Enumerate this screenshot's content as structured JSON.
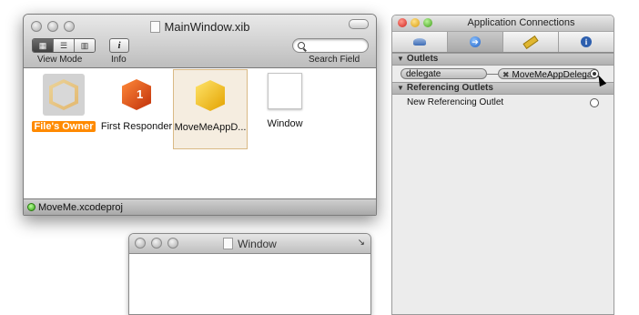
{
  "main_window": {
    "title": "MainWindow.xib",
    "toolbar": {
      "view_mode_label": "View Mode",
      "info_label": "Info",
      "info_glyph": "i",
      "search_label": "Search Field",
      "search_placeholder": ""
    },
    "objects": [
      {
        "label": "File's Owner",
        "icon": "placeholder-cube-icon",
        "selected": true
      },
      {
        "label": "First Responder",
        "icon": "first-responder-cube-icon"
      },
      {
        "label": "MoveMeAppD...",
        "icon": "object-cube-icon",
        "highlighted": true
      },
      {
        "label": "Window",
        "icon": "window-icon"
      }
    ],
    "status": {
      "project": "MoveMe.xcodeproj"
    }
  },
  "window_win": {
    "title": "Window"
  },
  "inspector": {
    "title": "Application Connections",
    "tabs": [
      {
        "icon": "attributes-icon",
        "active": false
      },
      {
        "icon": "connections-icon",
        "active": true
      },
      {
        "icon": "size-ruler-icon",
        "active": false
      },
      {
        "icon": "identity-info-icon",
        "active": false
      }
    ],
    "outlets": {
      "header": "Outlets",
      "items": [
        {
          "name": "delegate",
          "target": "MoveMeAppDelegate",
          "target_prefix": "✖"
        }
      ]
    },
    "referencing": {
      "header": "Referencing Outlets",
      "items": [
        {
          "name": "New Referencing Outlet"
        }
      ]
    }
  },
  "colors": {
    "selection_orange": "#ff8a00",
    "connections_blue": "#1f5fc4"
  }
}
